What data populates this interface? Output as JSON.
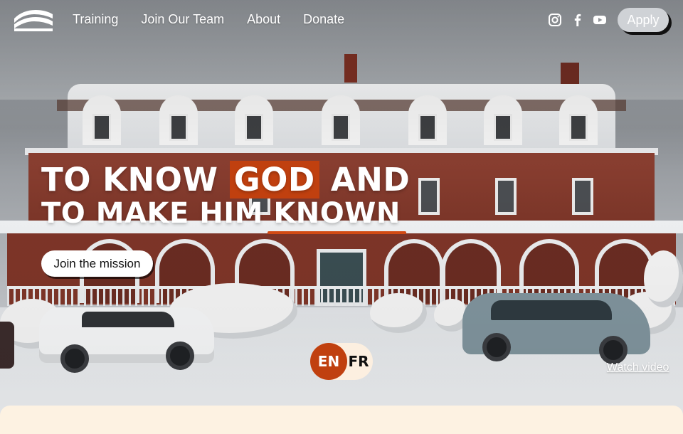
{
  "nav": {
    "links": [
      "Training",
      "Join Our Team",
      "About",
      "Donate"
    ],
    "social": [
      "instagram-icon",
      "facebook-icon",
      "youtube-icon"
    ],
    "apply_label": "Apply"
  },
  "hero": {
    "line1_pre": "TO KNOW ",
    "line1_highlight": "GOD",
    "line1_post": " AND",
    "line2_pre": "TO MAKE HIM ",
    "line2_underlined": "KNOWN",
    "cta_label": "Join the mission",
    "watch_video": "Watch video"
  },
  "language": {
    "active": "EN",
    "inactive": "FR"
  },
  "colors": {
    "accent": "#c0400f",
    "cream": "#fcefe0",
    "apply_bg": "#cfd2d6"
  }
}
